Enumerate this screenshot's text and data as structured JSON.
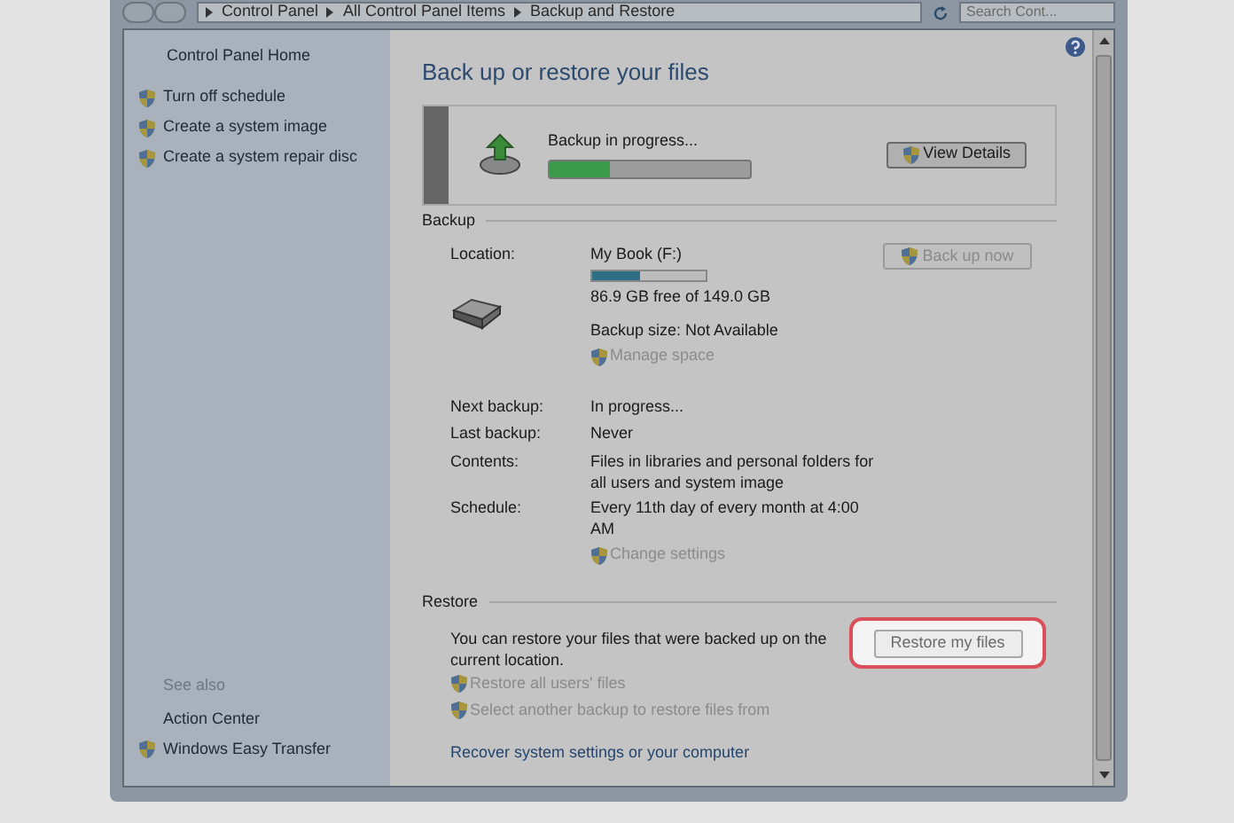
{
  "address_bar": {
    "breadcrumbs": [
      "Control Panel",
      "All Control Panel Items",
      "Backup and Restore"
    ],
    "search": {
      "placeholder": "Search Cont..."
    }
  },
  "sidebar": {
    "home": "Control Panel Home",
    "tasks": [
      {
        "label": "Turn off schedule",
        "shield": true
      },
      {
        "label": "Create a system image",
        "shield": true
      },
      {
        "label": "Create a system repair disc",
        "shield": true
      }
    ],
    "see_also": {
      "heading": "See also",
      "items": [
        {
          "label": "Action Center",
          "shield": false
        },
        {
          "label": "Windows Easy Transfer",
          "shield": true
        }
      ]
    }
  },
  "main": {
    "title": "Back up or restore your files",
    "status": {
      "text": "Backup in progress...",
      "level": 0.3,
      "button": "View Details"
    },
    "backup": {
      "heading": "Backup",
      "location_label": "Location:",
      "drive": {
        "name": "My Book (F:)",
        "level": 0.42,
        "free": "86.9 GB free of 149.0 GB",
        "size": "Backup size: Not Available"
      },
      "manage_link": {
        "label": "Manage space",
        "disabled": true
      },
      "button": {
        "label": "Back up now",
        "disabled": true
      },
      "details": [
        {
          "label": "Next backup:",
          "value": "In progress..."
        },
        {
          "label": "Last backup:",
          "value": "Never"
        },
        {
          "label": "Contents:",
          "value": "Files in libraries and personal folders for all users and system image"
        },
        {
          "label": "Schedule:",
          "value": "Every 11th day of every month at 4:00 AM"
        }
      ],
      "settings_link": {
        "label": "Change settings",
        "disabled": true
      }
    },
    "restore": {
      "heading": "Restore",
      "text": "You can restore your files that were backed up on the current location.",
      "button": {
        "label": "Restore my files",
        "highlighted": true
      },
      "links": [
        {
          "label": "Restore all users' files",
          "shield": true,
          "disabled": true
        },
        {
          "label": "Select another backup to restore files from",
          "shield": true,
          "disabled": true
        }
      ],
      "recover_link": "Recover system settings or your computer"
    }
  }
}
